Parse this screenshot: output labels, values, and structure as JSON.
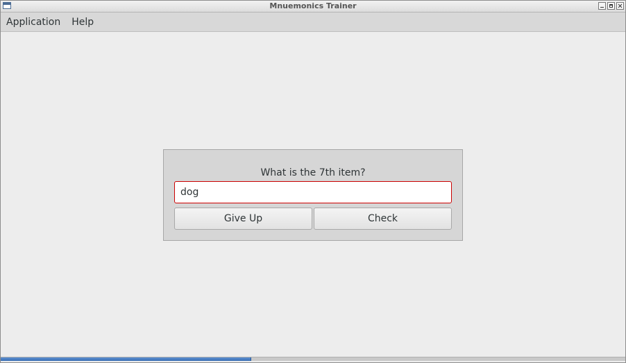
{
  "window": {
    "title": "Mnuemonics Trainer"
  },
  "menu": {
    "items": [
      {
        "label": "Application"
      },
      {
        "label": "Help"
      }
    ]
  },
  "quiz": {
    "question": "What is the 7th item?",
    "answer_value": "dog",
    "give_up_label": "Give Up",
    "check_label": "Check"
  },
  "progress": {
    "fraction": 0.4
  },
  "colors": {
    "accent": "#3b6fb4",
    "input_error_border": "#cc0000"
  }
}
